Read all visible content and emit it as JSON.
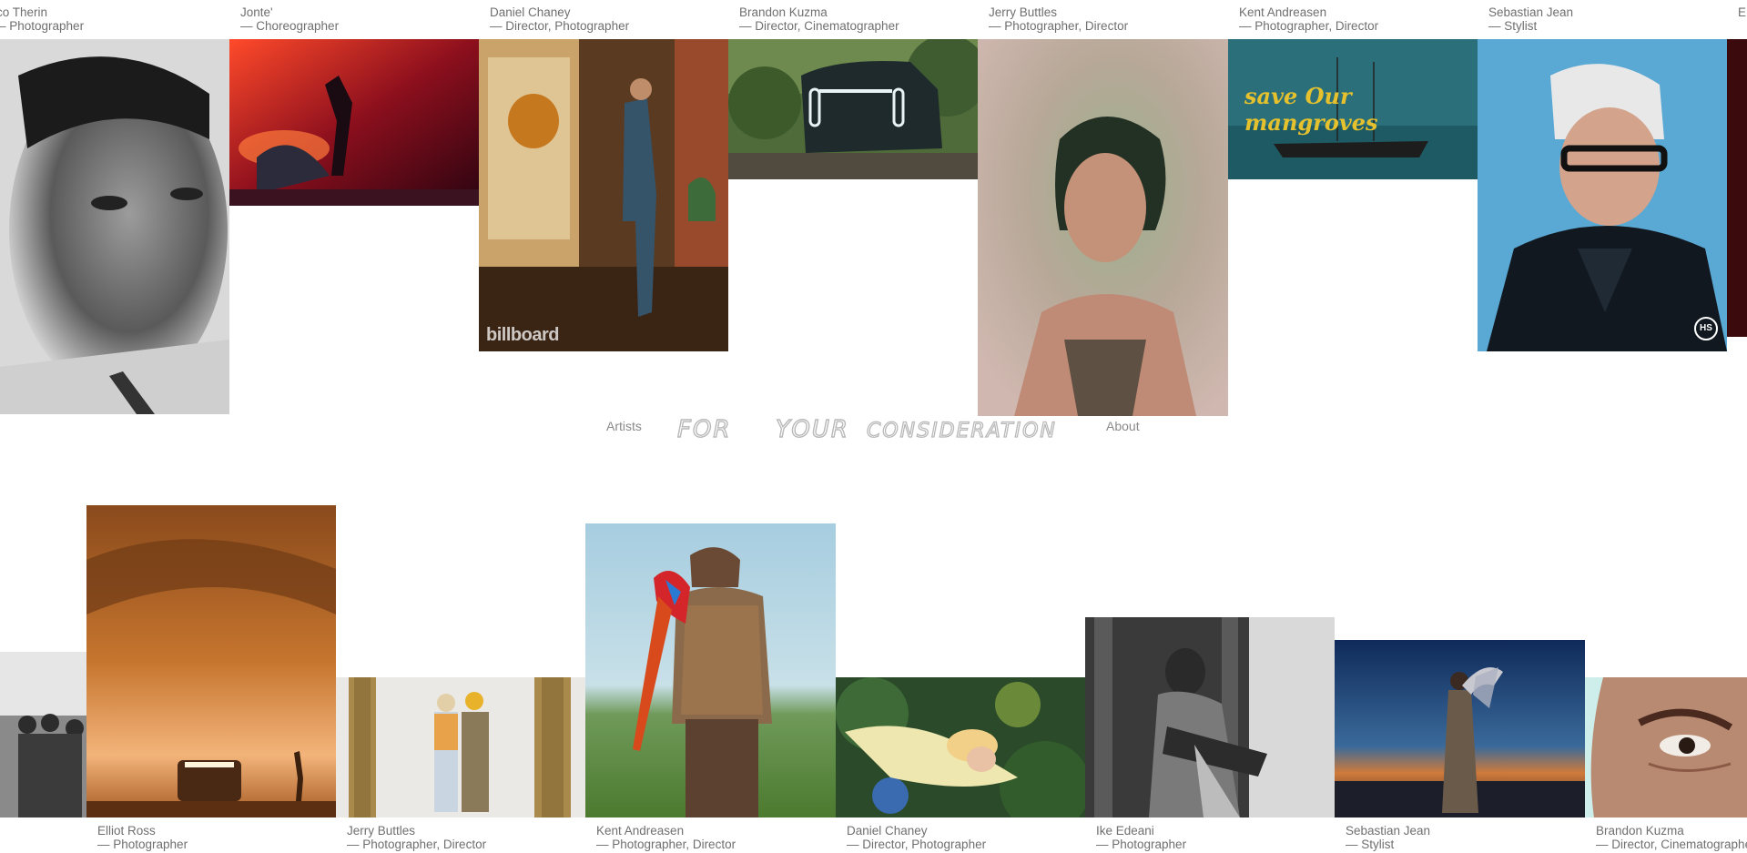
{
  "nav": {
    "artists_label": "Artists",
    "brand_words": [
      "FOR",
      "YOUR",
      "CONSIDERATION"
    ],
    "about_label": "About"
  },
  "top_row": [
    {
      "name": "ico Therin",
      "role": "— Photographer",
      "image": "black-and-white close-up portrait of a man"
    },
    {
      "name": "Jonte'",
      "role": "— Choreographer",
      "image": "performer on a red-lit stage"
    },
    {
      "name": "Daniel Chaney",
      "role": "— Director, Photographer",
      "image": "man in denim leaning against a brick wall in a wood-paneled room",
      "watermark": "billboard"
    },
    {
      "name": "Brandon Kuzma",
      "role": "— Director, Cinematographer",
      "image": "dark electric pickup truck parked in a forest"
    },
    {
      "name": "Jerry Buttles",
      "role": "— Photographer, Director",
      "image": "woman with bob haircut in green and pink light"
    },
    {
      "name": "Kent Andreasen",
      "role": "— Photographer, Director",
      "image": "boat on teal water with hand-lettered yellow text",
      "overlay_text": "save Our mangroves"
    },
    {
      "name": "Sebastian Jean",
      "role": "— Stylist",
      "image": "older man with white hair and glasses in leather coat",
      "badge": "HS"
    },
    {
      "name": "E",
      "role": "",
      "image": "dark red partial image"
    }
  ],
  "bottom_row": [
    {
      "name": "",
      "role": "",
      "image": "black-and-white group of men"
    },
    {
      "name": "Elliot Ross",
      "role": "— Photographer",
      "image": "truck in an orange desert haze with a walking figure"
    },
    {
      "name": "Jerry Buttles",
      "role": "— Photographer, Director",
      "image": "couple standing between ornate gold frames"
    },
    {
      "name": "Kent Andreasen",
      "role": "— Photographer, Director",
      "image": "man in knit vest with a macaw on his shoulder in a field"
    },
    {
      "name": "Daniel Chaney",
      "role": "— Director, Photographer",
      "image": "blonde woman lying among flowers"
    },
    {
      "name": "Ike Edeani",
      "role": "— Photographer",
      "image": "black-and-white woman sitting in a doorway"
    },
    {
      "name": "Sebastian Jean",
      "role": "— Stylist",
      "image": "figure in patterned outfit at dusk holding a sculptural object"
    },
    {
      "name": "Brandon Kuzma",
      "role": "— Director, Cinematographer",
      "image": "extreme close-up of an eye"
    }
  ],
  "colors": {
    "text": "#6f6f6f",
    "nav_text": "#8a8a8a",
    "brand_stroke": "#b9b9b9",
    "background": "#ffffff"
  }
}
